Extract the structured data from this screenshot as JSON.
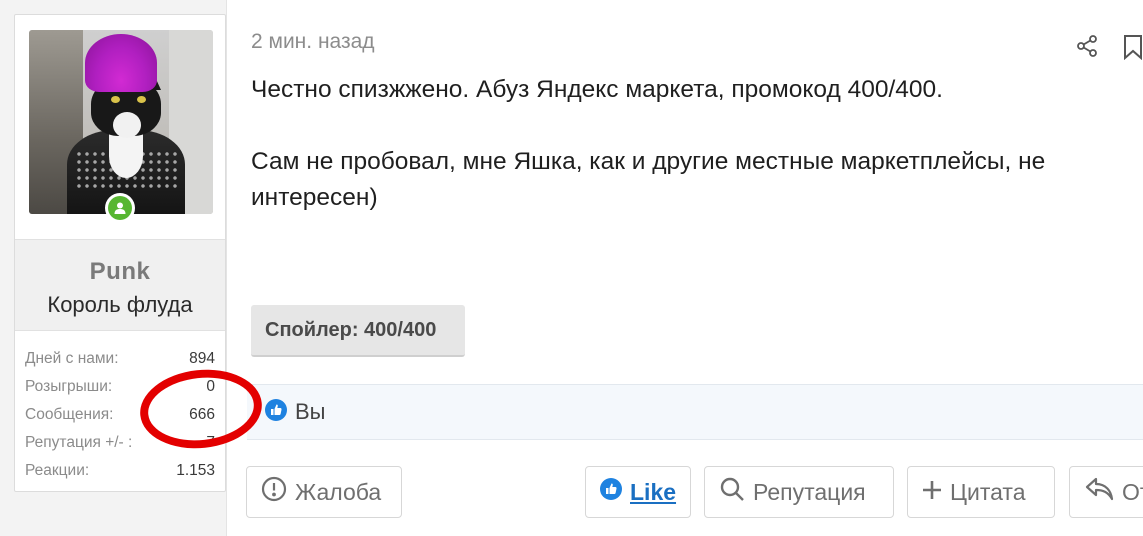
{
  "user": {
    "username": "Punk",
    "title": "Король флуда",
    "online": true,
    "stats": [
      {
        "label": "Дней с нами:",
        "value": "894"
      },
      {
        "label": "Розыгрыши:",
        "value": "0"
      },
      {
        "label": "Сообщения:",
        "value": "666"
      },
      {
        "label": "Репутация +/- :",
        "value": "7"
      },
      {
        "label": "Реакции:",
        "value": "1.153"
      }
    ]
  },
  "post": {
    "time": "2 мин. назад",
    "lines": [
      "Честно спизжжено. Абуз Яндекс маркета, промокод 400/400.",
      "Сам не пробовал, мне Яшка, как и другие местные маркетплейсы, не",
      "интересен)"
    ],
    "spoiler_label": "Спойлер: 400/400"
  },
  "reactions": {
    "who": "Вы"
  },
  "actions": {
    "report": "Жалоба",
    "like": "Like",
    "reputation": "Репутация",
    "quote": "Цитата",
    "reply": "Ответ"
  },
  "colors": {
    "online": "#57b631",
    "like": "#1a6fc2",
    "annotation_circle": "#e30000"
  },
  "icons": [
    "share-icon",
    "bookmark-icon",
    "user-icon",
    "thumbs-up-icon",
    "alert-icon",
    "search-icon",
    "plus-icon",
    "reply-icon"
  ]
}
